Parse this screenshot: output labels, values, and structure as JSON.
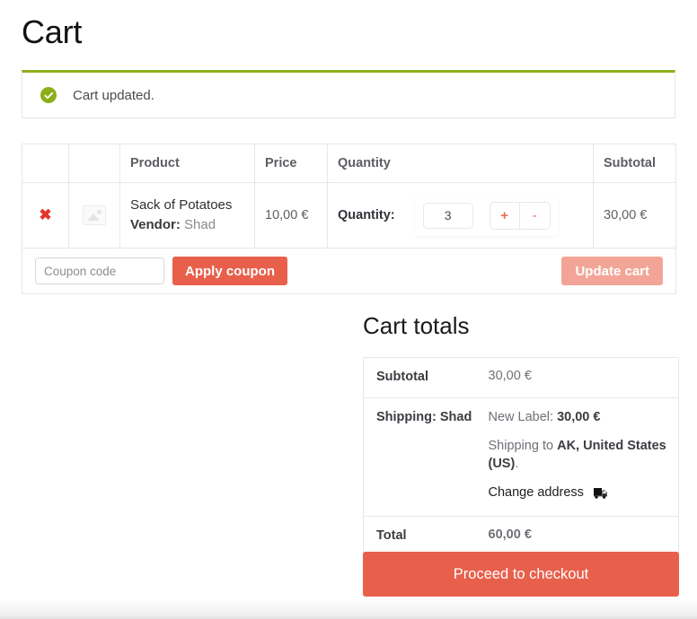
{
  "page": {
    "title": "Cart"
  },
  "notice": {
    "icon": "check-circle-icon",
    "message": "Cart updated."
  },
  "cart_table": {
    "headers": [
      "",
      "",
      "Product",
      "Price",
      "Quantity",
      "Subtotal"
    ],
    "rows": [
      {
        "remove_label": "✖",
        "thumbnail": "broken-image-placeholder",
        "product_name": "Sack of Potatoes",
        "vendor_label": "Vendor:",
        "vendor_name": "Shad",
        "price": "10,00 €",
        "quantity_label": "Quantity:",
        "quantity_value": "3",
        "increment_label": "+",
        "decrement_label": "-",
        "subtotal": "30,00 €"
      }
    ],
    "coupon": {
      "placeholder": "Coupon code",
      "value": "",
      "apply_label": "Apply coupon",
      "update_label": "Update cart"
    }
  },
  "cart_totals": {
    "heading": "Cart totals",
    "subtotal": {
      "label": "Subtotal",
      "value": "30,00 €"
    },
    "shipping": {
      "label": "Shipping: Shad",
      "method_prefix": "New Label: ",
      "method_amount": "30,00 €",
      "shipping_to_prefix": "Shipping to ",
      "shipping_to_place": "AK, United States (US)",
      "shipping_to_suffix": ".",
      "change_address_label": "Change address",
      "change_address_icon": "delivery-truck-icon"
    },
    "total": {
      "label": "Total",
      "value": "60,00 €"
    }
  },
  "checkout": {
    "label": "Proceed to checkout"
  },
  "colors": {
    "accent": "#e8604c",
    "accent_disabled": "#f2a596",
    "notice_green": "#8fae1b",
    "remove_red": "#e4352a"
  }
}
